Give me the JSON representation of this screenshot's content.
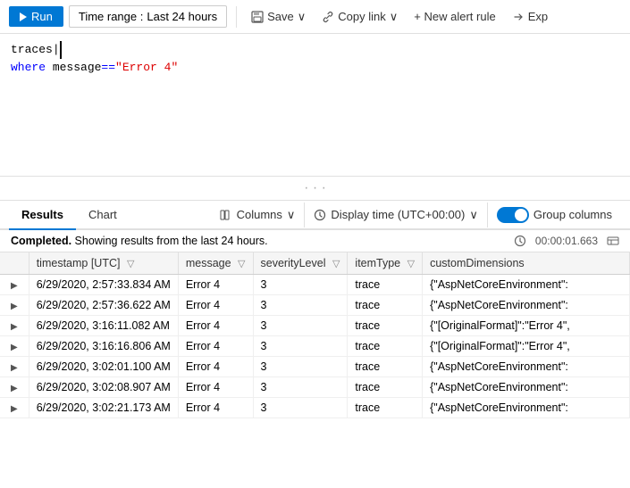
{
  "toolbar": {
    "run_label": "Run",
    "time_range_label": "Time range :",
    "time_range_value": "Last 24 hours",
    "save_label": "Save",
    "copy_link_label": "Copy link",
    "new_alert_label": "+ New alert rule",
    "export_label": "Exp"
  },
  "query": {
    "line1": "traces |",
    "line2_keyword": "where",
    "line2_field": "message",
    "line2_op": "==",
    "line2_value": "\"Error 4\""
  },
  "tabs": {
    "results_label": "Results",
    "chart_label": "Chart"
  },
  "tools": {
    "columns_label": "Columns",
    "display_time_label": "Display time (UTC+00:00)",
    "group_columns_label": "Group columns"
  },
  "status": {
    "text_bold": "Completed.",
    "text_rest": " Showing results from the last 24 hours.",
    "duration": "00:00:01.663"
  },
  "table": {
    "columns": [
      {
        "key": "expand",
        "label": ""
      },
      {
        "key": "timestamp",
        "label": "timestamp [UTC]"
      },
      {
        "key": "message",
        "label": "message"
      },
      {
        "key": "severityLevel",
        "label": "severityLevel"
      },
      {
        "key": "itemType",
        "label": "itemType"
      },
      {
        "key": "customDimensions",
        "label": "customDimensions"
      }
    ],
    "rows": [
      {
        "timestamp": "6/29/2020, 2:57:33.834 AM",
        "message": "Error 4",
        "severityLevel": "3",
        "itemType": "trace",
        "customDimensions": "{\"AspNetCoreEnvironment\":"
      },
      {
        "timestamp": "6/29/2020, 2:57:36.622 AM",
        "message": "Error 4",
        "severityLevel": "3",
        "itemType": "trace",
        "customDimensions": "{\"AspNetCoreEnvironment\":"
      },
      {
        "timestamp": "6/29/2020, 3:16:11.082 AM",
        "message": "Error 4",
        "severityLevel": "3",
        "itemType": "trace",
        "customDimensions": "{\"[OriginalFormat]\":\"Error 4\","
      },
      {
        "timestamp": "6/29/2020, 3:16:16.806 AM",
        "message": "Error 4",
        "severityLevel": "3",
        "itemType": "trace",
        "customDimensions": "{\"[OriginalFormat]\":\"Error 4\","
      },
      {
        "timestamp": "6/29/2020, 3:02:01.100 AM",
        "message": "Error 4",
        "severityLevel": "3",
        "itemType": "trace",
        "customDimensions": "{\"AspNetCoreEnvironment\":"
      },
      {
        "timestamp": "6/29/2020, 3:02:08.907 AM",
        "message": "Error 4",
        "severityLevel": "3",
        "itemType": "trace",
        "customDimensions": "{\"AspNetCoreEnvironment\":"
      },
      {
        "timestamp": "6/29/2020, 3:02:21.173 AM",
        "message": "Error 4",
        "severityLevel": "3",
        "itemType": "trace",
        "customDimensions": "{\"AspNetCoreEnvironment\":"
      }
    ]
  }
}
